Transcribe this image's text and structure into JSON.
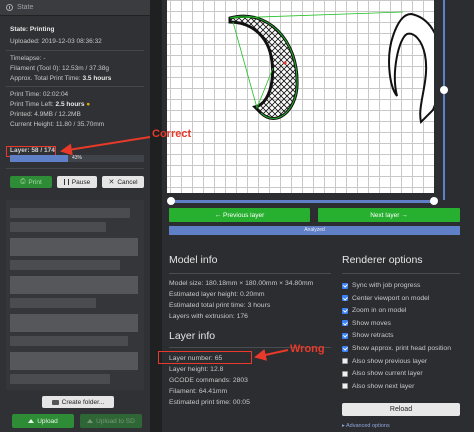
{
  "sidebar": {
    "state_title": "State",
    "state_line": "State: Printing",
    "uploaded": "Uploaded: 2019-12-03 08:36:32",
    "timelapse": "Timelapse: -",
    "filament": "Filament (Tool 0): 12.53m / 37.38g",
    "approx_total": {
      "label": "Approx. Total Print Time: ",
      "value": "3.5 hours"
    },
    "print_time": "Print Time: 02:02:04",
    "print_time_left": {
      "label": "Print Time Left: ",
      "value": "2.5 hours"
    },
    "printed": "Printed: 4.9MB / 12.2MB",
    "current_height": "Current Height: 11.80 / 35.70mm",
    "layer": "Layer: 58 / 174",
    "progress_percent": 43,
    "progress_label": "43%",
    "print_btn": "Print",
    "pause_btn": "Pause",
    "cancel_btn": "Cancel",
    "create_folder": "Create folder...",
    "upload": "Upload",
    "upload_sd": "Upload to SD"
  },
  "viewer": {
    "prev_layer": "← Previous layer",
    "next_layer": "Next layer →",
    "status": "Analyzed"
  },
  "model_info": {
    "title": "Model info",
    "lines": [
      "Model size: 180.18mm × 180.00mm × 34.80mm",
      "Estimated layer height: 0.20mm",
      "Estimated total print time: 3 hours",
      "Layers with extrusion: 176"
    ]
  },
  "layer_info": {
    "title": "Layer info",
    "lines": [
      "Layer number: 65",
      "Layer height: 12.8",
      "GCODE commands: 2803",
      "Filament: 64.41mm",
      "Estimated print time: 00:05"
    ]
  },
  "renderer": {
    "title": "Renderer options",
    "options": [
      {
        "label": "Sync with job progress",
        "checked": true
      },
      {
        "label": "Center viewport on model",
        "checked": true
      },
      {
        "label": "Zoom in on model",
        "checked": true
      },
      {
        "label": "Show moves",
        "checked": true
      },
      {
        "label": "Show retracts",
        "checked": true
      },
      {
        "label": "Show approx. print head position",
        "checked": true
      },
      {
        "label": "Also show previous layer",
        "checked": false
      },
      {
        "label": "Also show current layer",
        "checked": false
      },
      {
        "label": "Also show next layer",
        "checked": false
      }
    ],
    "reload": "Reload",
    "advanced": "▸ Advanced options"
  },
  "annotations": {
    "correct": "Correct",
    "wrong": "Wrong"
  },
  "colors": {
    "accent": "#5f7fc7",
    "green": "#27b02f",
    "annotation": "#e8392a"
  }
}
